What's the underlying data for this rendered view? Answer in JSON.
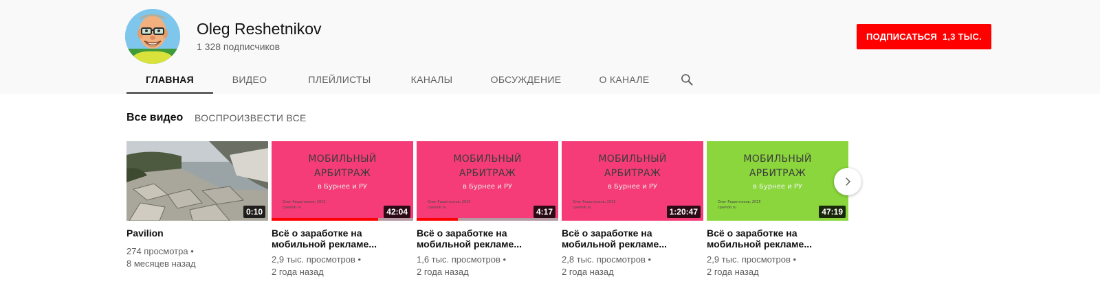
{
  "channel": {
    "name": "Oleg Reshetnikov",
    "subscribers": "1 328 подписчиков",
    "avatar_icon": "avatar-cartoon-man-icon"
  },
  "subscribe": {
    "label": "ПОДПИСАТЬСЯ",
    "count": "1,3 ТЫС.",
    "color": "#ff0000"
  },
  "tabs": [
    {
      "label": "ГЛАВНАЯ",
      "active": true
    },
    {
      "label": "ВИДЕО",
      "active": false
    },
    {
      "label": "ПЛЕЙЛИСТЫ",
      "active": false
    },
    {
      "label": "КАНАЛЫ",
      "active": false
    },
    {
      "label": "ОБСУЖДЕНИЕ",
      "active": false
    },
    {
      "label": "О КАНАЛЕ",
      "active": false
    }
  ],
  "search_icon": "search-icon",
  "section": {
    "title": "Все видео",
    "play_all": "ВОСПРОИЗВЕСТИ ВСЕ"
  },
  "videos": [
    {
      "title": "Pavilion",
      "duration": "0:10",
      "views": "274 просмотра",
      "age": "8 месяцев назад",
      "thumbnail": "photo",
      "watched_fraction": 0
    },
    {
      "title": "Всё о заработке на мобильной рекламе...",
      "duration": "42:04",
      "views": "2,9 тыс. просмотров",
      "age": "2 года назад",
      "thumbnail": "pink",
      "thumb_line1": "МОБИЛЬНЫЙ",
      "thumb_line2": "АРБИТРАЖ",
      "thumb_line3": "в Бурнее и РУ",
      "thumb_small1": "Олег Решетников, 2015",
      "thumb_small2": "cpamob.ru",
      "watched_fraction": 0.75
    },
    {
      "title": "Всё о заработке на мобильной рекламе...",
      "duration": "4:17",
      "views": "1,6 тыс. просмотров",
      "age": "2 года назад",
      "thumbnail": "pink",
      "thumb_line1": "МОБИЛЬНЫЙ",
      "thumb_line2": "АРБИТРАЖ",
      "thumb_line3": "в Бурнее и РУ",
      "thumb_small1": "Олег Решетников, 2015",
      "thumb_small2": "cpamob.ru",
      "watched_fraction": 0.29
    },
    {
      "title": "Всё о заработке на мобильной рекламе...",
      "duration": "1:20:47",
      "views": "2,8 тыс. просмотров",
      "age": "2 года назад",
      "thumbnail": "pink",
      "thumb_line1": "МОБИЛЬНЫЙ",
      "thumb_line2": "АРБИТРАЖ",
      "thumb_line3": "в Бурнее и РУ",
      "thumb_small1": "Олег Решетников, 2015",
      "thumb_small2": "cpamob.ru",
      "watched_fraction": 0
    },
    {
      "title": "Всё о заработке на мобильной рекламе...",
      "duration": "47:19",
      "views": "2,9 тыс. просмотров",
      "age": "2 года назад",
      "thumbnail": "green",
      "thumb_line1": "МОБИЛЬНЫЙ",
      "thumb_line2": "АРБИТРАЖ",
      "thumb_line3": "в Бурнее и РУ",
      "thumb_small1": "Олег Решетников, 2015",
      "thumb_small2": "cpamob.ru",
      "watched_fraction": 0
    }
  ],
  "meta_separator": "•",
  "next_icon": "chevron-right-icon",
  "colors": {
    "header_bg": "#f9f9f9",
    "pink_thumb": "#f53c79",
    "green_thumb": "#8ad63c",
    "progress": "#ff0000"
  }
}
